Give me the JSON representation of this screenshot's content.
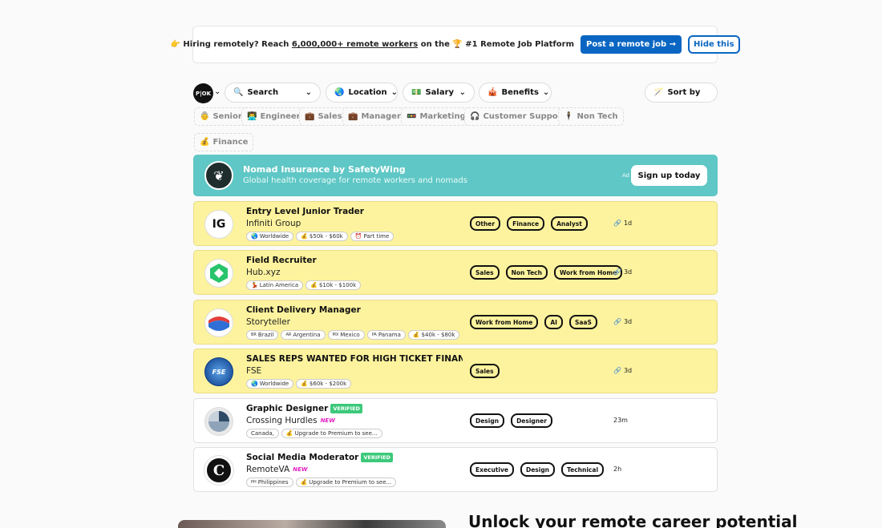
{
  "banner": {
    "emoji": "👉",
    "text_a": "Hiring remotely? Reach",
    "text_u": "6,000,000+ remote workers",
    "text_b": "on the",
    "trophy": "🏆",
    "text_c": "#1 Remote Job Platform",
    "post_btn": "Post a remote job →",
    "hide_btn": "Hide this"
  },
  "filters": {
    "logo": "P|OK",
    "search": {
      "icon": "🔍",
      "label": "Search"
    },
    "location": {
      "icon": "🌏",
      "label": "Location"
    },
    "salary": {
      "icon": "💵",
      "label": "Salary"
    },
    "benefits": {
      "icon": "🎪",
      "label": "Benefits"
    },
    "sort": {
      "icon": "🪄",
      "label": "Sort by"
    },
    "chevron": "⌄"
  },
  "tags": [
    {
      "icon": "👵",
      "label": "Senior"
    },
    {
      "icon": "👨‍💻",
      "label": "Engineer"
    },
    {
      "icon": "💼",
      "label": "Sales"
    },
    {
      "icon": "💼",
      "label": "Manager"
    },
    {
      "icon": "🚥",
      "label": "Marketing"
    },
    {
      "icon": "🎧",
      "label": "Customer Support"
    },
    {
      "icon": "🕴",
      "label": "Non Tech"
    },
    {
      "icon": "💰",
      "label": "Finance"
    }
  ],
  "ad": {
    "title": "Nomad Insurance by SafetyWing",
    "subtitle": "Global health coverage for remote workers and nomads",
    "label": "Ad",
    "button": "Sign up today"
  },
  "jobs": [
    {
      "title": "Entry Level Junior Trader",
      "company": "Infiniti Group",
      "logo": "IG",
      "verified": "",
      "new": "",
      "chips": [
        {
          "icon": "🌏",
          "text": "Worldwide"
        },
        {
          "icon": "💰",
          "text": "$50k - $60k"
        },
        {
          "icon": "⏰",
          "text": "Part time"
        }
      ],
      "tags": [
        "Other",
        "Finance",
        "Analyst"
      ],
      "time": "1d",
      "time_icon": "🔗"
    },
    {
      "title": "Field Recruiter",
      "company": "Hub.xyz",
      "logo": "",
      "verified": "",
      "new": "",
      "chips": [
        {
          "icon": "💃",
          "text": "Latin America"
        },
        {
          "icon": "💰",
          "text": "$10k - $100k"
        }
      ],
      "tags": [
        "Sales",
        "Non Tech",
        "Work from Home"
      ],
      "time": "3d",
      "time_icon": "🔗"
    },
    {
      "title": "Client Delivery Manager",
      "company": "Storyteller",
      "logo": "",
      "verified": "",
      "new": "",
      "chips": [
        {
          "icon": "BR",
          "text": "Brazil"
        },
        {
          "icon": "AR",
          "text": "Argentina"
        },
        {
          "icon": "MX",
          "text": "Mexico"
        },
        {
          "icon": "PA",
          "text": "Panama"
        },
        {
          "icon": "💰",
          "text": "$40k - $80k"
        }
      ],
      "tags": [
        "Work from Home",
        "AI",
        "SaaS"
      ],
      "time": "3d",
      "time_icon": "🔗"
    },
    {
      "title": "SALES REPS WANTED FOR HIGH TICKET FINANCE SA...",
      "company": "FSE",
      "logo": "",
      "verified": "",
      "new": "",
      "chips": [
        {
          "icon": "🌏",
          "text": "Worldwide"
        },
        {
          "icon": "💰",
          "text": "$60k - $200k"
        }
      ],
      "tags": [
        "Sales"
      ],
      "time": "3d",
      "time_icon": "🔗"
    },
    {
      "title": "Graphic Designer",
      "company": "Crossing Hurdles",
      "logo": "",
      "verified": "VERIFIED",
      "new": "NEW",
      "chips": [
        {
          "icon": "",
          "text": "Canada,"
        },
        {
          "icon": "💰",
          "text": "Upgrade to Premium to see..."
        }
      ],
      "tags": [
        "Design",
        "Designer"
      ],
      "time": "23m",
      "time_icon": ""
    },
    {
      "title": "Social Media Moderator",
      "company": "RemoteVA",
      "logo": "C",
      "verified": "VERIFIED",
      "new": "NEW",
      "chips": [
        {
          "icon": "PH",
          "text": "Philippines"
        },
        {
          "icon": "💰",
          "text": "Upgrade to Premium to see..."
        }
      ],
      "tags": [
        "Executive",
        "Design",
        "Technical"
      ],
      "time": "2h",
      "time_icon": ""
    }
  ],
  "promo": {
    "title": "Unlock your remote career potential"
  },
  "colors": {
    "highlight": "#fdf39e",
    "accent": "#0a66c2",
    "ad": "#5fc7c5",
    "verified": "#3cc97b"
  }
}
